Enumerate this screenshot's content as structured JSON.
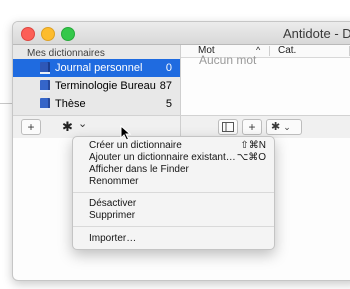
{
  "window": {
    "title": "Antidote - Dict"
  },
  "sidebar": {
    "header": "Mes dictionnaires",
    "items": [
      {
        "label": "Journal personnel",
        "count": "0"
      },
      {
        "label": "Terminologie Bureau",
        "count": "87"
      },
      {
        "label": "Thèse",
        "count": "5"
      }
    ]
  },
  "toolbar": {
    "add_label": "+",
    "gear_label": "✱",
    "chevron": "⌄"
  },
  "list": {
    "columns": {
      "word": "Mot",
      "sort_indicator": "^",
      "category": "Cat."
    },
    "empty_text": "Aucun mot"
  },
  "menu": {
    "items": [
      {
        "label": "Créer un dictionnaire",
        "shortcut": "⇧⌘N"
      },
      {
        "label": "Ajouter un dictionnaire existant…",
        "shortcut": "⌥⌘O"
      },
      {
        "label": "Afficher dans le Finder",
        "shortcut": ""
      },
      {
        "label": "Renommer",
        "shortcut": ""
      },
      {
        "label": "Désactiver",
        "shortcut": ""
      },
      {
        "label": "Supprimer",
        "shortcut": ""
      },
      {
        "label": "Importer…",
        "shortcut": ""
      }
    ]
  },
  "colors": {
    "selection": "#1f6be0",
    "book": "#3565c9"
  }
}
